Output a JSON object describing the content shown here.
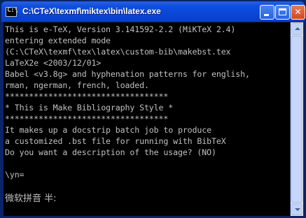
{
  "window": {
    "title": "C:\\CTeX\\texmf\\miktex\\bin\\latex.exe",
    "icon": "console-icon",
    "icon_glyph": "C:\\"
  },
  "title_buttons": {
    "minimize_icon": "minimize-icon",
    "maximize_icon": "maximize-icon",
    "close_icon": "close-icon",
    "close_glyph": "✕"
  },
  "console": {
    "lines": [
      "This is e-TeX, Version 3.141592-2.2 (MiKTeX 2.4)",
      "entering extended mode",
      "(C:\\CTeX\\texmf\\tex\\latex\\custom-bib\\makebst.tex",
      "LaTeX2e <2003/12/01>",
      "Babel <v3.8g> and hyphenation patterns for english,",
      "rman, ngerman, french, loaded.",
      "**********************************",
      "* This is Make Bibliography Style *",
      "**********************************",
      "It makes up a docstrip batch job to produce",
      "a customized .bst file for running with BibTeX",
      "Do you want a description of the usage? (NO)",
      "",
      "\\yn="
    ],
    "ime_status": "微软拼音 半:"
  },
  "colors": {
    "console_bg": "#000000",
    "console_fg": "#c0c0c0",
    "titlebar": "#0a46d6"
  }
}
